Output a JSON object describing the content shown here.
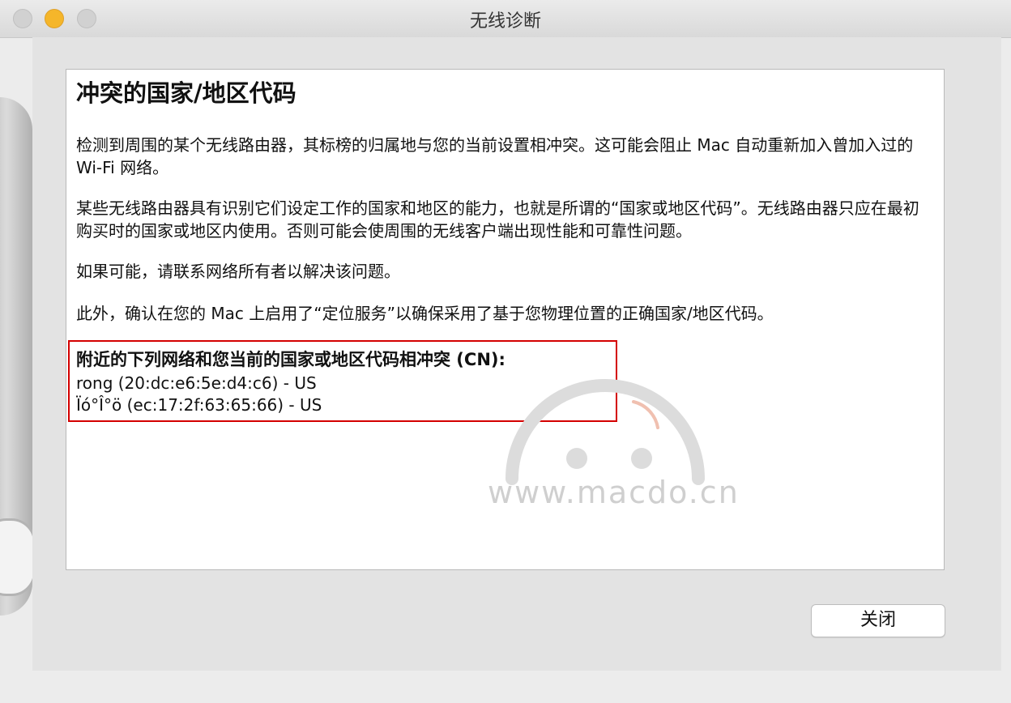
{
  "window": {
    "title": "无线诊断"
  },
  "content": {
    "heading": "冲突的国家/地区代码",
    "paragraphs": [
      "检测到周围的某个无线路由器，其标榜的归属地与您的当前设置相冲突。这可能会阻止 Mac 自动重新加入曾加入过的 Wi-Fi 网络。",
      "某些无线路由器具有识别它们设定工作的国家和地区的能力，也就是所谓的“国家或地区代码”。无线路由器只应在最初购买时的国家或地区内使用。否则可能会使周围的无线客户端出现性能和可靠性问题。",
      "如果可能，请联系网络所有者以解决该问题。",
      "此外，确认在您的 Mac 上启用了“定位服务”以确保采用了基于您物理位置的正确国家/地区代码。"
    ],
    "conflict_title": "附近的下列网络和您当前的国家或地区代码相冲突 (CN):",
    "networks": [
      "rong (20:dc:e6:5e:d4:c6) - US",
      "Ïó°Î°ö (ec:17:2f:63:65:66) - US"
    ],
    "watermark": "www.macdo.cn"
  },
  "footer": {
    "close_label": "关闭"
  },
  "colors": {
    "highlight_border": "#d40000",
    "minimize_button": "#f5b62a"
  }
}
